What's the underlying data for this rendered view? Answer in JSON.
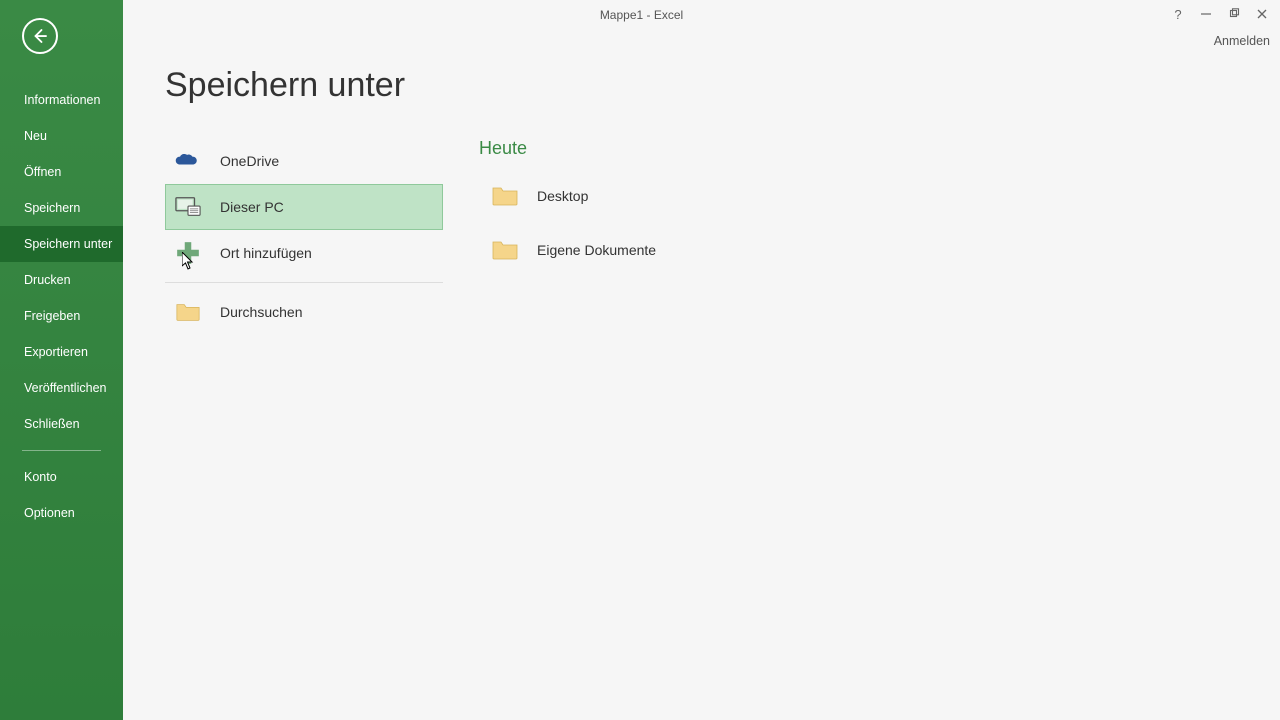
{
  "window": {
    "title": "Mappe1 - Excel",
    "signin": "Anmelden"
  },
  "sidebar": {
    "items": [
      {
        "label": "Informationen"
      },
      {
        "label": "Neu"
      },
      {
        "label": "Öffnen"
      },
      {
        "label": "Speichern"
      },
      {
        "label": "Speichern unter"
      },
      {
        "label": "Drucken"
      },
      {
        "label": "Freigeben"
      },
      {
        "label": "Exportieren"
      },
      {
        "label": "Veröffentlichen"
      },
      {
        "label": "Schließen"
      }
    ],
    "footer": [
      {
        "label": "Konto"
      },
      {
        "label": "Optionen"
      }
    ]
  },
  "page": {
    "heading": "Speichern unter",
    "locations": [
      {
        "label": "OneDrive"
      },
      {
        "label": "Dieser PC"
      },
      {
        "label": "Ort hinzufügen"
      },
      {
        "label": "Durchsuchen"
      }
    ],
    "recent": {
      "section": "Heute",
      "folders": [
        {
          "label": "Desktop"
        },
        {
          "label": "Eigene Dokumente"
        }
      ]
    }
  }
}
